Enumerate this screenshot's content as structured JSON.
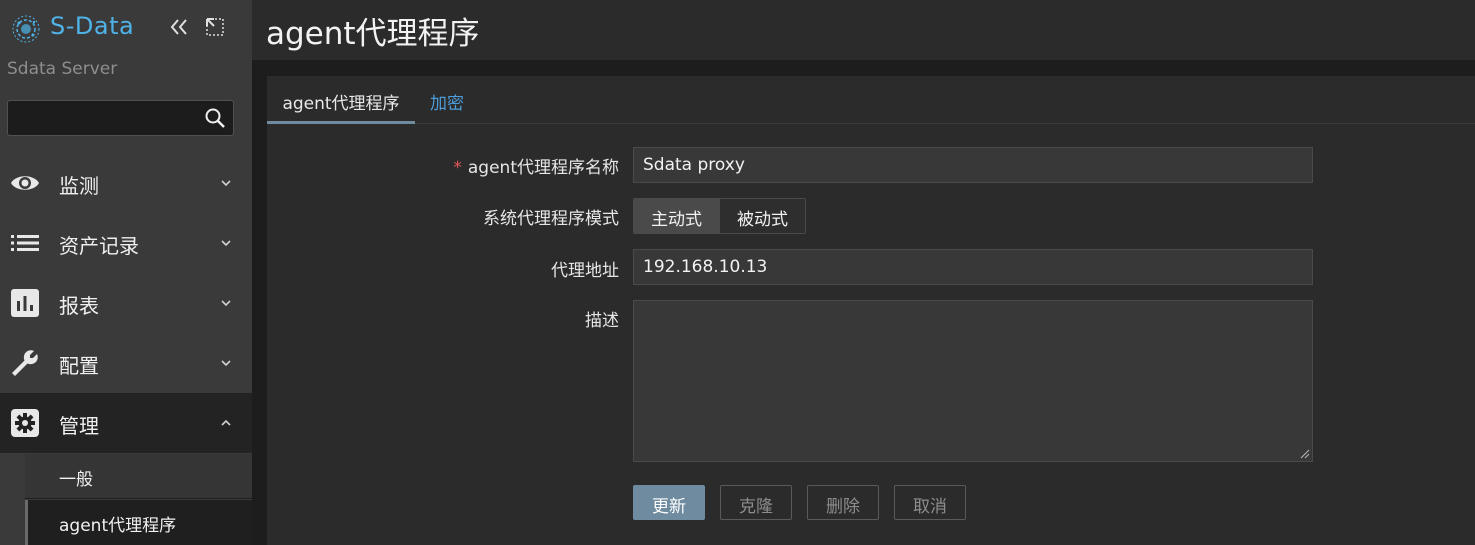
{
  "brand": {
    "name": "S-Data",
    "accent": "#4fb3e8"
  },
  "sidebar": {
    "server_name": "Sdata Server",
    "search": {
      "value": "",
      "placeholder": ""
    },
    "menu": [
      {
        "label": "监测",
        "icon": "eye-icon"
      },
      {
        "label": "资产记录",
        "icon": "list-icon"
      },
      {
        "label": "报表",
        "icon": "bar-chart-icon"
      },
      {
        "label": "配置",
        "icon": "wrench-icon"
      },
      {
        "label": "管理",
        "icon": "gear-icon",
        "expanded": true
      }
    ],
    "submenu": [
      {
        "label": "一般"
      },
      {
        "label": "agent代理程序",
        "selected": true
      }
    ]
  },
  "header": {
    "title": "agent代理程序"
  },
  "tabs": [
    {
      "label": "agent代理程序",
      "active": true
    },
    {
      "label": "加密",
      "active": false
    }
  ],
  "form": {
    "name_label": "agent代理程序名称",
    "name_required_mark": "*",
    "name_value": "Sdata proxy",
    "mode_label": "系统代理程序模式",
    "mode_options": [
      "主动式",
      "被动式"
    ],
    "mode_selected": "主动式",
    "address_label": "代理地址",
    "address_value": "192.168.10.13",
    "description_label": "描述",
    "description_value": ""
  },
  "buttons": {
    "update": "更新",
    "clone": "克隆",
    "delete": "删除",
    "cancel": "取消"
  },
  "colors": {
    "primary_button": "#6e8ba0",
    "link": "#4c9dd8",
    "required": "#e45959"
  }
}
